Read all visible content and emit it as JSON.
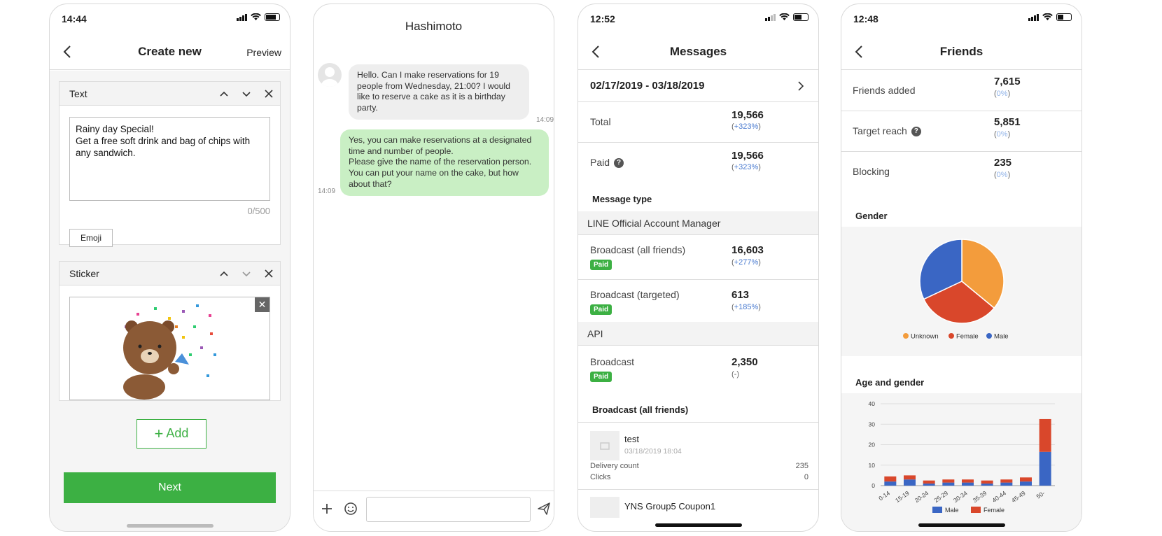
{
  "screen1": {
    "status_time": "14:44",
    "title": "Create new",
    "preview_label": "Preview",
    "text_card": {
      "label": "Text",
      "content": "Rainy day Special!\nGet a free soft drink and bag of chips with any sandwich.",
      "counter": "0/500",
      "emoji_label": "Emoji"
    },
    "sticker_card": {
      "label": "Sticker"
    },
    "add_label": "Add",
    "next_label": "Next"
  },
  "screen2": {
    "title": "Hashimoto",
    "incoming": {
      "text": "Hello. Can I make reservations for 19 people from Wednesday, 21:00? I would like to reserve a cake as it is a birthday party.",
      "time": "14:09"
    },
    "outgoing": {
      "text": "Yes, you can make reservations at a designated time and number of people.\nPlease give the name of the reservation person. You can put your name on the cake, but how about that?",
      "time": "14:09"
    }
  },
  "screen3": {
    "status_time": "12:52",
    "title": "Messages",
    "date_range": "02/17/2019 - 03/18/2019",
    "total": {
      "label": "Total",
      "value": "19,566",
      "pct": "+323%"
    },
    "paid": {
      "label": "Paid",
      "value": "19,566",
      "pct": "+323%"
    },
    "message_type_label": "Message type",
    "group1_label": "LINE Official Account Manager",
    "bc_all": {
      "label": "Broadcast (all friends)",
      "badge": "Paid",
      "value": "16,603",
      "pct": "+277%"
    },
    "bc_targeted": {
      "label": "Broadcast (targeted)",
      "badge": "Paid",
      "value": "613",
      "pct": "+185%"
    },
    "group2_label": "API",
    "api_bc": {
      "label": "Broadcast",
      "badge": "Paid",
      "value": "2,350",
      "pct": "(-)"
    },
    "bc_section_label": "Broadcast (all friends)",
    "item1": {
      "name": "test",
      "date": "03/18/2019 18:04",
      "delivery_label": "Delivery count",
      "delivery_value": "235",
      "clicks_label": "Clicks",
      "clicks_value": "0"
    },
    "item2_name": "YNS Group5 Coupon1"
  },
  "screen4": {
    "status_time": "12:48",
    "title": "Friends",
    "friends_added": {
      "label": "Friends added",
      "value": "7,615",
      "pct": "0%"
    },
    "target_reach": {
      "label": "Target reach",
      "value": "5,851",
      "pct": "0%"
    },
    "blocking": {
      "label": "Blocking",
      "value": "235",
      "pct": "0%"
    },
    "gender_title": "Gender",
    "age_title": "Age and gender"
  },
  "colors": {
    "line_green": "#3cb043",
    "bubble_out": "#c9efc4",
    "male": "#3a66c4",
    "female": "#d9472b",
    "unknown": "#f39c3c"
  },
  "chart_data": [
    {
      "type": "pie",
      "title": "Gender",
      "categories": [
        "Unknown",
        "Female",
        "Male"
      ],
      "values": [
        36,
        32,
        32
      ],
      "colors": [
        "#f39c3c",
        "#d9472b",
        "#3a66c4"
      ],
      "legend": "bottom"
    },
    {
      "type": "bar",
      "stacked": true,
      "title": "Age and gender",
      "categories": [
        "0-14",
        "15-19",
        "20-24",
        "25-29",
        "30-34",
        "35-39",
        "40-44",
        "45-49",
        "50-"
      ],
      "series": [
        {
          "name": "Male",
          "values": [
            2,
            3,
            1,
            1.5,
            1.5,
            1,
            1.5,
            2,
            16.5
          ],
          "color": "#3a66c4"
        },
        {
          "name": "Female",
          "values": [
            2.5,
            2,
            1.5,
            1.5,
            1.5,
            1.5,
            1.5,
            2,
            16
          ],
          "color": "#d9472b"
        }
      ],
      "ylim": [
        0,
        40
      ],
      "yticks": [
        0,
        10,
        20,
        30,
        40
      ],
      "grid": true,
      "legend": "bottom"
    }
  ]
}
